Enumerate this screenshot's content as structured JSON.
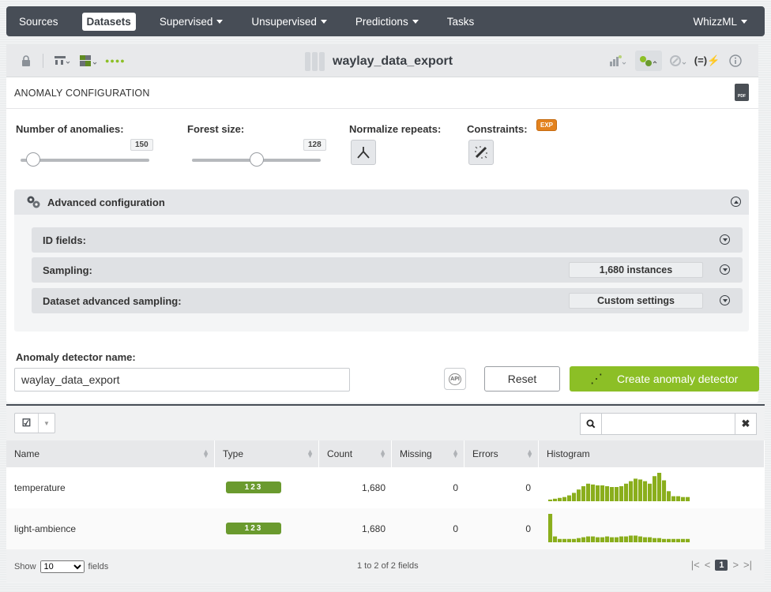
{
  "nav": {
    "items": [
      {
        "label": "Sources",
        "caret": false,
        "active": false
      },
      {
        "label": "Datasets",
        "caret": false,
        "active": true
      },
      {
        "label": "Supervised",
        "caret": true,
        "active": false
      },
      {
        "label": "Unsupervised",
        "caret": true,
        "active": false
      },
      {
        "label": "Predictions",
        "caret": true,
        "active": false
      },
      {
        "label": "Tasks",
        "caret": false,
        "active": false
      }
    ],
    "right_label": "WhizzML"
  },
  "toolbar": {
    "dataset_name": "waylay_data_export"
  },
  "section": {
    "title": "ANOMALY CONFIGURATION",
    "pdf_icon_label": "PDF"
  },
  "params": {
    "num_anomalies_label": "Number of anomalies:",
    "num_anomalies_value": "150",
    "num_anomalies_level": 0.1,
    "forest_size_label": "Forest size:",
    "forest_size_value": "128",
    "forest_size_level": 0.5,
    "normalize_label": "Normalize repeats:",
    "constraints_label": "Constraints:",
    "exp_badge": "EXP"
  },
  "advanced": {
    "title": "Advanced configuration",
    "rows": [
      {
        "label": "ID fields:",
        "value": ""
      },
      {
        "label": "Sampling:",
        "value": "1,680 instances"
      },
      {
        "label": "Dataset advanced sampling:",
        "value": "Custom settings"
      }
    ]
  },
  "form": {
    "name_label": "Anomaly detector name:",
    "name_value": "waylay_data_export",
    "api_label": "API",
    "reset_label": "Reset",
    "create_label": "Create anomaly detector"
  },
  "table": {
    "search_value": "",
    "columns": [
      "Name",
      "Type",
      "Count",
      "Missing",
      "Errors",
      "Histogram"
    ],
    "rows": [
      {
        "name": "temperature",
        "type": "123",
        "count": "1,680",
        "missing": "0",
        "errors": "0",
        "hist": [
          2,
          3,
          4,
          5,
          7,
          10,
          14,
          18,
          21,
          20,
          19,
          19,
          18,
          17,
          17,
          18,
          21,
          24,
          27,
          26,
          24,
          21,
          30,
          34,
          25,
          12,
          6,
          6,
          5,
          5
        ]
      },
      {
        "name": "light-ambience",
        "type": "123",
        "count": "1,680",
        "missing": "0",
        "errors": "0",
        "hist": [
          34,
          7,
          4,
          4,
          4,
          4,
          5,
          6,
          7,
          7,
          6,
          6,
          7,
          6,
          6,
          7,
          7,
          8,
          8,
          7,
          6,
          6,
          5,
          5,
          4,
          4,
          4,
          4,
          4,
          4
        ]
      }
    ],
    "footer": {
      "show_label": "Show",
      "page_size": "10",
      "fields_label": "fields",
      "range_text": "1 to 2 of 2 fields",
      "current_page": "1"
    }
  },
  "colors": {
    "accent_green": "#8cbf26",
    "nav_bg": "#474d56",
    "exp_orange": "#e3821e",
    "hist_bar": "#8aae1c"
  }
}
